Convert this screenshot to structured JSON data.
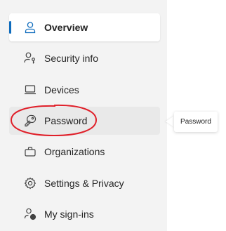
{
  "nav": {
    "items": [
      {
        "label": "Overview",
        "icon": "person-icon",
        "selected": true
      },
      {
        "label": "Security info",
        "icon": "person-key-icon"
      },
      {
        "label": "Devices",
        "icon": "laptop-icon"
      },
      {
        "label": "Password",
        "icon": "key-icon",
        "hover": true
      },
      {
        "label": "Organizations",
        "icon": "briefcase-icon"
      },
      {
        "label": "Settings & Privacy",
        "icon": "gear-icon"
      },
      {
        "label": "My sign-ins",
        "icon": "person-sync-icon"
      }
    ]
  },
  "tooltip": {
    "text": "Password"
  },
  "colors": {
    "accent": "#0f6cbd",
    "highlight": "#e0202a",
    "sidebar_bg": "#f3f3f3"
  }
}
